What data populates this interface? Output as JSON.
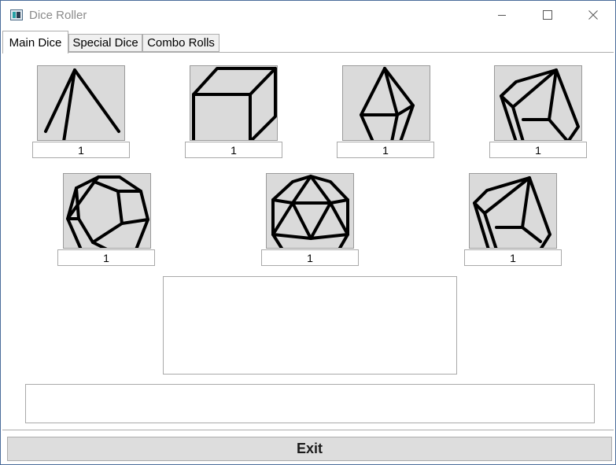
{
  "window": {
    "title": "Dice Roller"
  },
  "titlebar_buttons": [
    "minimize-icon",
    "maximize-icon",
    "close-icon"
  ],
  "tabs": [
    {
      "label": "Main Dice",
      "selected": true
    },
    {
      "label": "Special Dice",
      "selected": false
    },
    {
      "label": "Combo Rolls",
      "selected": false
    }
  ],
  "dice": [
    {
      "icon": "d4-icon",
      "value": "1"
    },
    {
      "icon": "d6-icon",
      "value": "1"
    },
    {
      "icon": "d8-icon",
      "value": "1"
    },
    {
      "icon": "d10-icon",
      "value": "1"
    },
    {
      "icon": "d12-icon",
      "value": "1"
    },
    {
      "icon": "d20-icon",
      "value": "1"
    },
    {
      "icon": "d100-icon",
      "value": "1"
    }
  ],
  "results_text": "",
  "total_text": "",
  "exit_button": {
    "label": "Exit"
  }
}
